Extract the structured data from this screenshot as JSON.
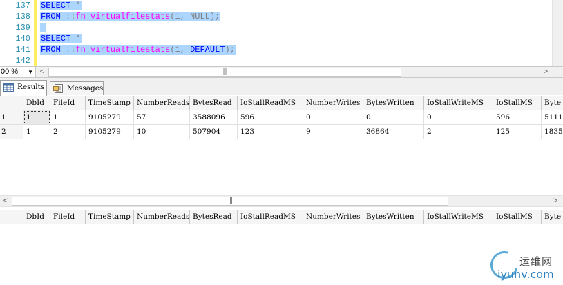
{
  "editor": {
    "line_numbers": [
      "137",
      "138",
      "139",
      "140",
      "141",
      "142"
    ],
    "lines": [
      {
        "parts": [
          {
            "t": "SELECT",
            "c": "kw"
          },
          {
            "t": " *",
            "c": "gr"
          }
        ]
      },
      {
        "parts": [
          {
            "t": "FROM",
            "c": "kw"
          },
          {
            "t": " ::",
            "c": "gr"
          },
          {
            "t": "fn_virtualfilestats",
            "c": "fn"
          },
          {
            "t": "(1, NULL);",
            "c": "gr"
          }
        ]
      },
      {
        "parts": [
          {
            "t": " ",
            "c": "gr"
          }
        ]
      },
      {
        "parts": [
          {
            "t": "SELECT",
            "c": "kw"
          },
          {
            "t": " *",
            "c": "gr"
          }
        ]
      },
      {
        "parts": [
          {
            "t": "FROM",
            "c": "kw"
          },
          {
            "t": " ::",
            "c": "gr"
          },
          {
            "t": "fn_virtualfilestats",
            "c": "fn"
          },
          {
            "t": "(1, ",
            "c": "gr"
          },
          {
            "t": "DEFAULT",
            "c": "kw"
          },
          {
            "t": ");",
            "c": "gr"
          }
        ]
      },
      {
        "parts": []
      }
    ],
    "selected_lines": [
      0,
      1,
      2,
      3,
      4
    ],
    "zoom": "00 %"
  },
  "tabs": [
    {
      "label": "Results",
      "icon": "grid-results-icon",
      "active": true
    },
    {
      "label": "Messages",
      "icon": "messages-icon",
      "active": false
    }
  ],
  "grid_columns": [
    "DbId",
    "FileId",
    "TimeStamp",
    "NumberReads",
    "BytesRead",
    "IoStallReadMS",
    "NumberWrites",
    "BytesWritten",
    "IoStallWriteMS",
    "IoStallMS",
    "Byte"
  ],
  "grid1": {
    "rows": [
      {
        "rownum": "1",
        "cells": [
          "1",
          "1",
          "9105279",
          "57",
          "3588096",
          "596",
          "0",
          "0",
          "0",
          "596",
          "5111"
        ]
      },
      {
        "rownum": "2",
        "cells": [
          "1",
          "2",
          "9105279",
          "10",
          "507904",
          "123",
          "9",
          "36864",
          "2",
          "125",
          "1835"
        ]
      }
    ]
  },
  "grid2": {
    "rows": []
  },
  "watermark": {
    "cn": "运维网",
    "url": "iyunv.com"
  },
  "colors": {
    "keyword": "#0000ff",
    "function": "#ff00ff",
    "punct": "#808080",
    "line_number": "#2b91af",
    "selection": "#add6ff",
    "change_bar": "#ffee62"
  }
}
